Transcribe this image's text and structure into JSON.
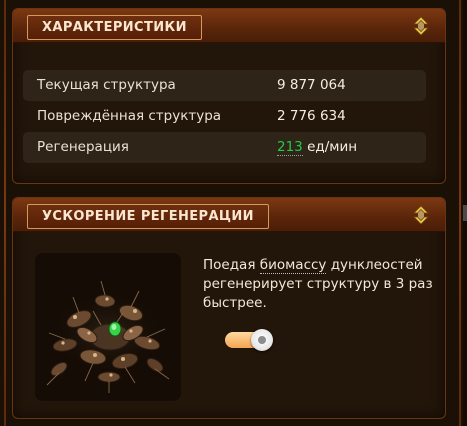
{
  "characteristics": {
    "title": "ХАРАКТЕРИСТИКИ",
    "collapse_icon": "chevron-collapse-icon",
    "stats": [
      {
        "label": "Текущая структура",
        "value": "9 877 064"
      },
      {
        "label": "Повреждённая структура",
        "value": "2 776 634"
      },
      {
        "label": "Регенерация",
        "value": "213",
        "unit": " ед/мин"
      }
    ]
  },
  "regen_boost": {
    "title": "УСКОРЕНИЕ РЕГЕНЕРАЦИИ",
    "collapse_icon": "chevron-collapse-icon",
    "creature_image": "creature-swarm-image",
    "description_before": "Поедая ",
    "description_link": "биомассу",
    "description_after": " дунклеостей регенерирует структуру в 3 раз быстрее.",
    "toggle_state": "on"
  },
  "colors": {
    "accent_orange": "#f2a552",
    "header_brown": "#7c3812",
    "regen_green": "#25c94a",
    "icon_gold": "#f0c84a"
  }
}
